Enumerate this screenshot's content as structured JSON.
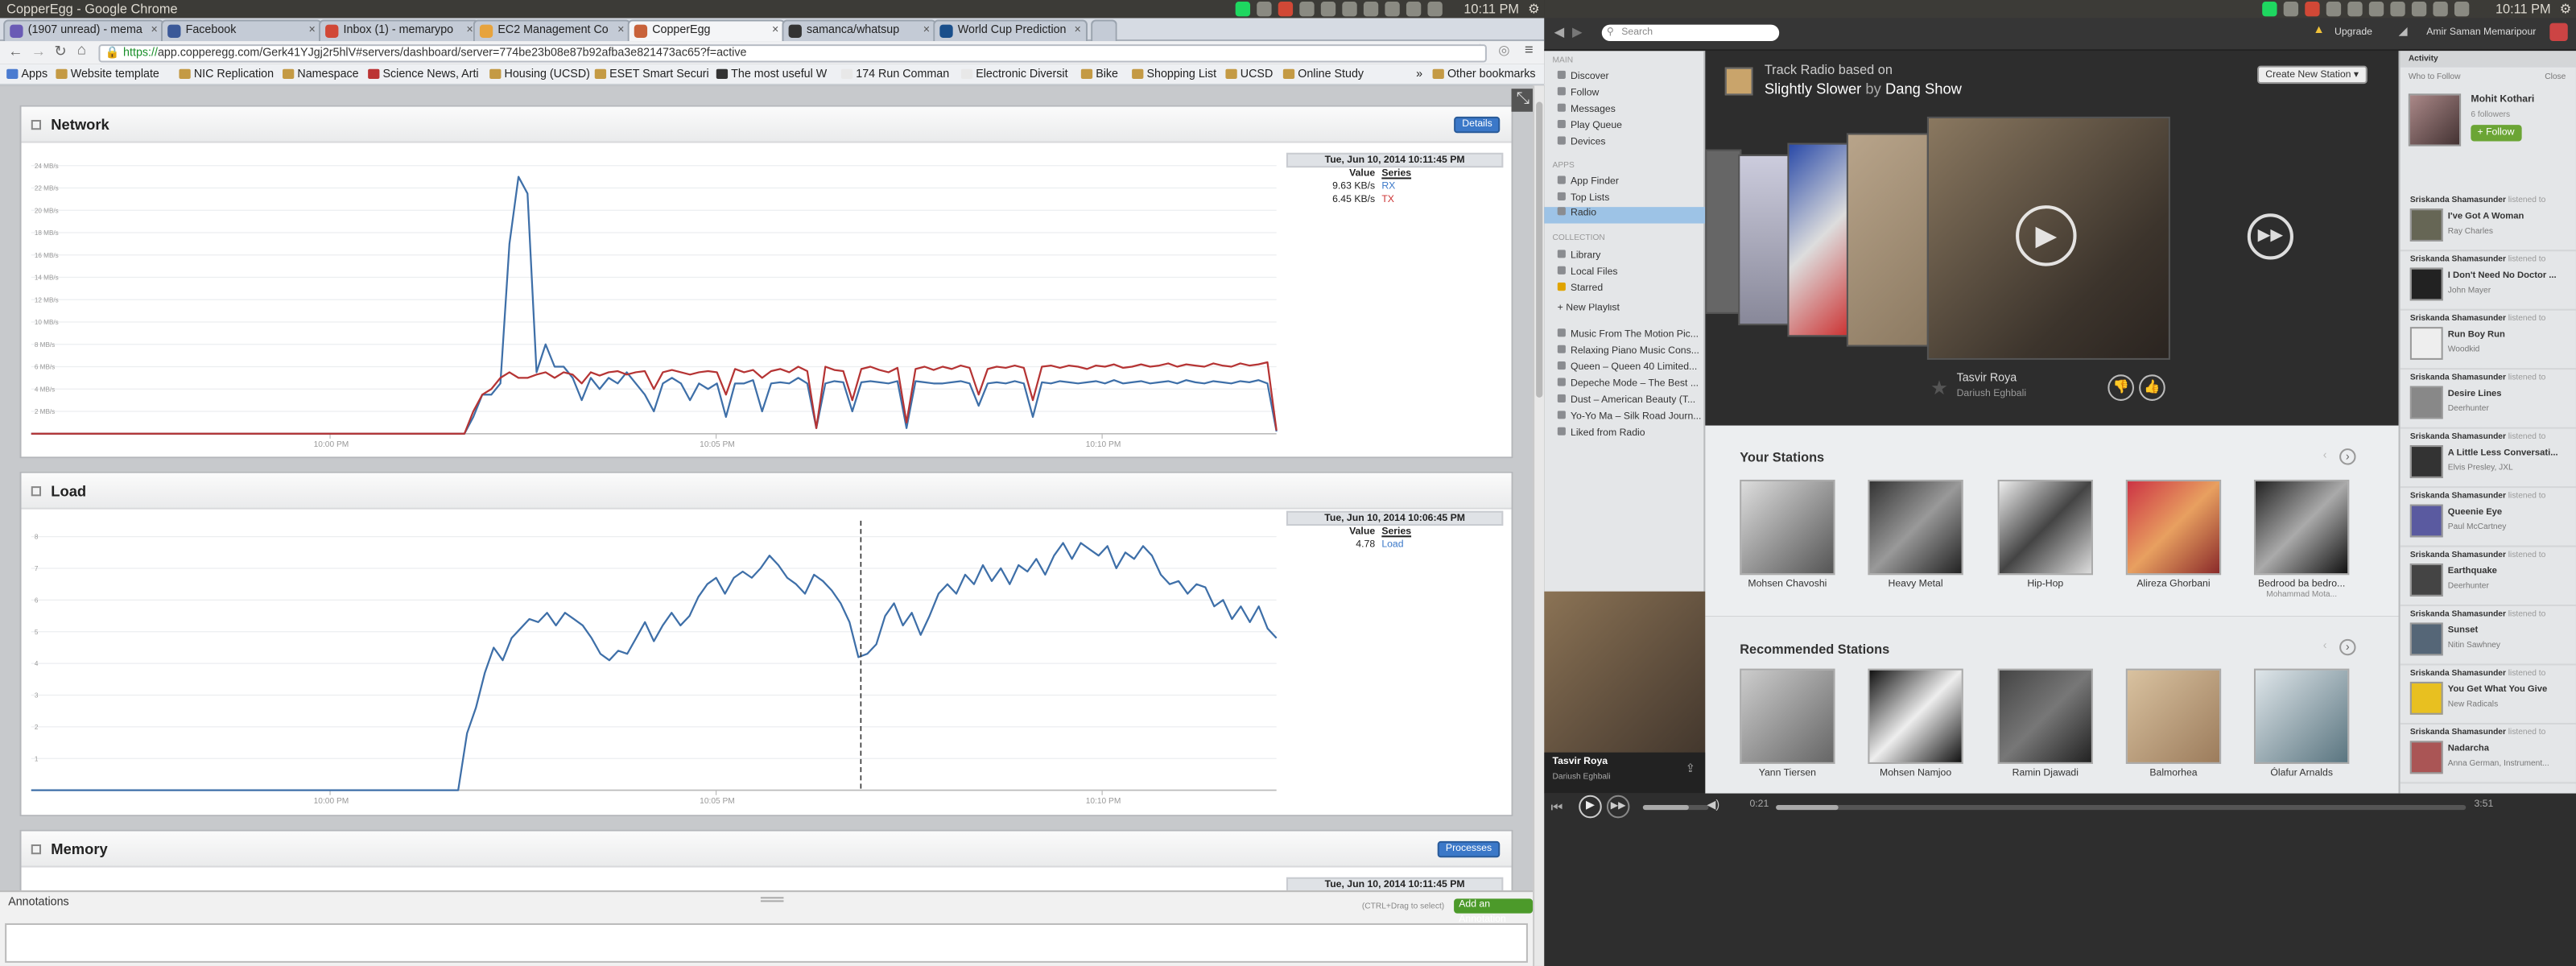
{
  "os": {
    "left_window_title": "CopperEgg - Google Chrome",
    "clock_left": "10:11 PM",
    "clock_right": "10:11 PM"
  },
  "chrome": {
    "tabs": [
      {
        "label": "(1907 unread) - mema",
        "color": "#6a5bb5"
      },
      {
        "label": "Facebook",
        "color": "#3b5998"
      },
      {
        "label": "Inbox (1) - memarypo",
        "color": "#d14836"
      },
      {
        "label": "EC2 Management Co",
        "color": "#e7a33c"
      },
      {
        "label": "CopperEgg",
        "color": "#c8623a"
      },
      {
        "label": "samanca/whatsup",
        "color": "#333333"
      },
      {
        "label": "World Cup Prediction",
        "color": "#1a4f8b"
      }
    ],
    "url_scheme": "https://",
    "url_rest": "app.copperegg.com/Gerk41YJgj2r5hlV#servers/dashboard/server=774be23b08e87b92afba3e821473ac65?f=active",
    "bookmarks": [
      "Apps",
      "Website template",
      "NIC Replication",
      "Namespace",
      "Science News, Arti",
      "Housing (UCSD)",
      "ESET Smart Securi",
      "The most useful W",
      "174 Run Comman",
      "Electronic Diversit",
      "Bike",
      "Shopping List",
      "UCSD",
      "Online Study",
      "Other bookmarks"
    ]
  },
  "network": {
    "title": "Network",
    "details_label": "Details",
    "legend_time": "Tue, Jun 10, 2014 10:11:45 PM",
    "legend_value_header": "Value",
    "legend_series_header": "Series",
    "rows": [
      {
        "value": "9.63 KB/s",
        "series": "RX"
      },
      {
        "value": "6.45 KB/s",
        "series": "TX"
      }
    ],
    "yticks": [
      "24 MB/s",
      "22 MB/s",
      "20 MB/s",
      "18 MB/s",
      "16 MB/s",
      "14 MB/s",
      "12 MB/s",
      "10 MB/s",
      "8 MB/s",
      "6 MB/s",
      "4 MB/s",
      "2 MB/s"
    ],
    "xticks": [
      "10:00 PM",
      "10:05 PM",
      "10:10 PM"
    ]
  },
  "load": {
    "title": "Load",
    "legend_time": "Tue, Jun 10, 2014 10:06:45 PM",
    "legend_value_header": "Value",
    "legend_series_header": "Series",
    "rows": [
      {
        "value": "4.78",
        "series": "Load"
      }
    ],
    "yticks": [
      "8",
      "7",
      "6",
      "5",
      "4",
      "3",
      "2",
      "1"
    ],
    "xticks": [
      "10:00 PM",
      "10:05 PM",
      "10:10 PM"
    ]
  },
  "memory": {
    "title": "Memory",
    "processes_label": "Processes",
    "legend_time": "Tue, Jun 10, 2014 10:11:45 PM"
  },
  "annotations": {
    "title": "Annotations",
    "hint": "(CTRL+Drag to select)",
    "add_label": "Add an Annotation"
  },
  "spotify": {
    "search_placeholder": "Search",
    "upgrade_label": "Upgrade",
    "user_name": "Amir Saman Memaripour",
    "sidebar": {
      "main_header": "MAIN",
      "main": [
        "Discover",
        "Follow",
        "Messages",
        "Play Queue",
        "Devices"
      ],
      "apps_header": "APPS",
      "apps": [
        "App Finder",
        "Top Lists",
        "Radio"
      ],
      "collection_header": "COLLECTION",
      "collection": [
        "Library",
        "Local Files",
        "Starred"
      ],
      "new_playlist": "New Playlist",
      "playlists": [
        "Music From The Motion Pic...",
        "Relaxing Piano Music Cons...",
        "Queen – Queen 40 Limited...",
        "Depeche Mode – The Best ...",
        "Dust – American Beauty (T...",
        "Yo-Yo Ma – Silk Road Journ...",
        "Liked from Radio"
      ]
    },
    "radio": {
      "based_on": "Track Radio based on",
      "track": "Slightly Slower",
      "by": "by",
      "artist": "Dang Show",
      "create_station": "Create New Station",
      "now_title": "Tasvir Roya",
      "now_artist": "Dariush Eghbali"
    },
    "your_stations_title": "Your Stations",
    "your_stations": [
      {
        "name": "Mohsen Chavoshi",
        "sub": ""
      },
      {
        "name": "Heavy Metal",
        "sub": ""
      },
      {
        "name": "Hip-Hop",
        "sub": ""
      },
      {
        "name": "Alireza Ghorbani",
        "sub": ""
      },
      {
        "name": "Bedrood ba bedro...",
        "sub": "Mohammad Mota..."
      }
    ],
    "recommended_title": "Recommended Stations",
    "recommended": [
      {
        "name": "Yann Tiersen"
      },
      {
        "name": "Mohsen Namjoo"
      },
      {
        "name": "Ramin Djawadi"
      },
      {
        "name": "Balmorhea"
      },
      {
        "name": "Ólafur Arnalds"
      }
    ],
    "activity": {
      "title": "Activity",
      "who_to_follow": "Who to Follow",
      "close": "Close",
      "suggest_name": "Mohit Kothari",
      "suggest_followers": "6 followers",
      "follow_label": "Follow",
      "items": [
        {
          "user": "Sriskanda Shamasunder",
          "verb": "listened to",
          "track": "I've Got A Woman",
          "artist": "Ray Charles"
        },
        {
          "user": "Sriskanda Shamasunder",
          "verb": "listened to",
          "track": "I Don't Need No Doctor ...",
          "artist": "John Mayer"
        },
        {
          "user": "Sriskanda Shamasunder",
          "verb": "listened to",
          "track": "Run Boy Run",
          "artist": "Woodkid"
        },
        {
          "user": "Sriskanda Shamasunder",
          "verb": "listened to",
          "track": "Desire Lines",
          "artist": "Deerhunter"
        },
        {
          "user": "Sriskanda Shamasunder",
          "verb": "listened to",
          "track": "A Little Less Conversati...",
          "artist": "Elvis Presley, JXL"
        },
        {
          "user": "Sriskanda Shamasunder",
          "verb": "listened to",
          "track": "Queenie Eye",
          "artist": "Paul McCartney"
        },
        {
          "user": "Sriskanda Shamasunder",
          "verb": "listened to",
          "track": "Earthquake",
          "artist": "Deerhunter"
        },
        {
          "user": "Sriskanda Shamasunder",
          "verb": "listened to",
          "track": "Sunset",
          "artist": "Nitin Sawhney"
        },
        {
          "user": "Sriskanda Shamasunder",
          "verb": "listened to",
          "track": "You Get What You Give",
          "artist": "New Radicals"
        },
        {
          "user": "Sriskanda Shamasunder",
          "verb": "listened to",
          "track": "Nadarcha",
          "artist": "Anna German, Instrument..."
        }
      ]
    },
    "player": {
      "track": "Tasvir Roya",
      "artist": "Dariush Eghbali",
      "elapsed": "0:21",
      "duration": "3:51",
      "progress": 0.09,
      "volume": 0.7
    }
  },
  "chart_data": [
    {
      "type": "line",
      "title": "Network",
      "ylim": [
        0,
        25
      ],
      "series": [
        {
          "name": "RX",
          "values": [
            0,
            0,
            0,
            0,
            0,
            0,
            0,
            0,
            0,
            0,
            0,
            0,
            0,
            0,
            0,
            0,
            0,
            0,
            0,
            0,
            0,
            0,
            0,
            0,
            0,
            0,
            0,
            0,
            0,
            0,
            0,
            0,
            0,
            0,
            0,
            0,
            0,
            0,
            0,
            0,
            0,
            0,
            0,
            0,
            0,
            0,
            0,
            0,
            0,
            1.5,
            3.5,
            3.5,
            4.5,
            17,
            23,
            21.5,
            5.5,
            8,
            6,
            6,
            5,
            3,
            5,
            4,
            5,
            4.5,
            5.5,
            4.5,
            3.5,
            2,
            4.5,
            5,
            4.5,
            3,
            4.5,
            4,
            4.5,
            1.5,
            4.5,
            4.5,
            4.8,
            2,
            4.5,
            4.6,
            4.5,
            5,
            4.5,
            0.5,
            4.5,
            4.7,
            4.6,
            2,
            4.6,
            4.7,
            4.6,
            4.5,
            4.7,
            0.5,
            4.7,
            4.6,
            4.5,
            4.5,
            4.6,
            4.7,
            4.5,
            2.5,
            4.5,
            4.6,
            4.5,
            4.7,
            4.5,
            1.5,
            4.6,
            4.5,
            4.7,
            4.6,
            4.5,
            4.6,
            4.7,
            4.5,
            4.8,
            4.5,
            4.6,
            4.7,
            4.5,
            4.6,
            4.7,
            4.5,
            4.8,
            4.6,
            4.5,
            4.7,
            4.6,
            4.5,
            4.7,
            4.6,
            4.8,
            4.5,
            0.2
          ]
        },
        {
          "name": "TX",
          "values": [
            0,
            0,
            0,
            0,
            0,
            0,
            0,
            0,
            0,
            0,
            0,
            0,
            0,
            0,
            0,
            0,
            0,
            0,
            0,
            0,
            0,
            0,
            0,
            0,
            0,
            0,
            0,
            0,
            0,
            0,
            0,
            0,
            0,
            0,
            0,
            0,
            0,
            0,
            0,
            0,
            0,
            0,
            0,
            0,
            0,
            0,
            0,
            0,
            0,
            2,
            3.5,
            4,
            5,
            5.5,
            5,
            5,
            5.3,
            5.5,
            5,
            5.5,
            5.3,
            4.5,
            5.5,
            5.2,
            5.5,
            5.6,
            5.3,
            5.5,
            5.6,
            4,
            5.5,
            5.7,
            5.5,
            5.3,
            5.5,
            5.6,
            5.5,
            3.5,
            5.8,
            5.5,
            5.7,
            5,
            5.6,
            5.8,
            5.5,
            6,
            5.6,
            0.5,
            6,
            5.7,
            5.6,
            3,
            5.8,
            6,
            5.7,
            5.5,
            5.9,
            1,
            5.8,
            6,
            5.7,
            6,
            5.8,
            6.1,
            5.9,
            3.5,
            5.8,
            6,
            5.9,
            6.1,
            5.9,
            3,
            6,
            6.1,
            5.9,
            6.1,
            6,
            5.8,
            6.1,
            6,
            6.2,
            5.9,
            6,
            6.2,
            6,
            6.1,
            6.3,
            6,
            6.2,
            6.1,
            6,
            6.3,
            6.1,
            6,
            6.3,
            6.1,
            6.2,
            6.4,
            0.3
          ]
        }
      ]
    },
    {
      "type": "line",
      "title": "Load",
      "ylim": [
        0,
        8.5
      ],
      "series": [
        {
          "name": "Load",
          "values": [
            0,
            0,
            0,
            0,
            0,
            0,
            0,
            0,
            0,
            0,
            0,
            0,
            0,
            0,
            0,
            0,
            0,
            0,
            0,
            0,
            0,
            0,
            0,
            0,
            0,
            0,
            0,
            0,
            0,
            0,
            0,
            0,
            0,
            0,
            0,
            0,
            0,
            0,
            0,
            0,
            0,
            0,
            0,
            0,
            0,
            0,
            0,
            0,
            0,
            1.8,
            2.6,
            3.7,
            4.5,
            4.1,
            4.8,
            5.1,
            5.4,
            5.3,
            5.6,
            5.2,
            5.6,
            5.4,
            5.2,
            4.8,
            4.3,
            4.1,
            4.4,
            4.3,
            4.8,
            5.3,
            4.7,
            5.2,
            5.6,
            5.2,
            5.5,
            6.1,
            6.5,
            6.7,
            6.2,
            6.7,
            6.9,
            6.7,
            7,
            7.4,
            7.1,
            6.7,
            6.5,
            6.2,
            6.8,
            6.6,
            6.3,
            5.9,
            5.3,
            4.2,
            4.3,
            4.6,
            5.5,
            5.9,
            5.2,
            5.6,
            4.9,
            5.5,
            6.2,
            6.5,
            6.2,
            6.8,
            6.5,
            7.1,
            6.6,
            7,
            6.5,
            7.1,
            6.9,
            7.3,
            6.8,
            7.4,
            7.8,
            7.3,
            7.8,
            7.6,
            7.4,
            7.7,
            7,
            7.5,
            7.3,
            7.7,
            7.4,
            6.8,
            6.5,
            6.6,
            6.2,
            6.5,
            6.4,
            5.8,
            6,
            5.4,
            5.8,
            5.3,
            5.8,
            5.1,
            4.8
          ]
        }
      ]
    }
  ]
}
